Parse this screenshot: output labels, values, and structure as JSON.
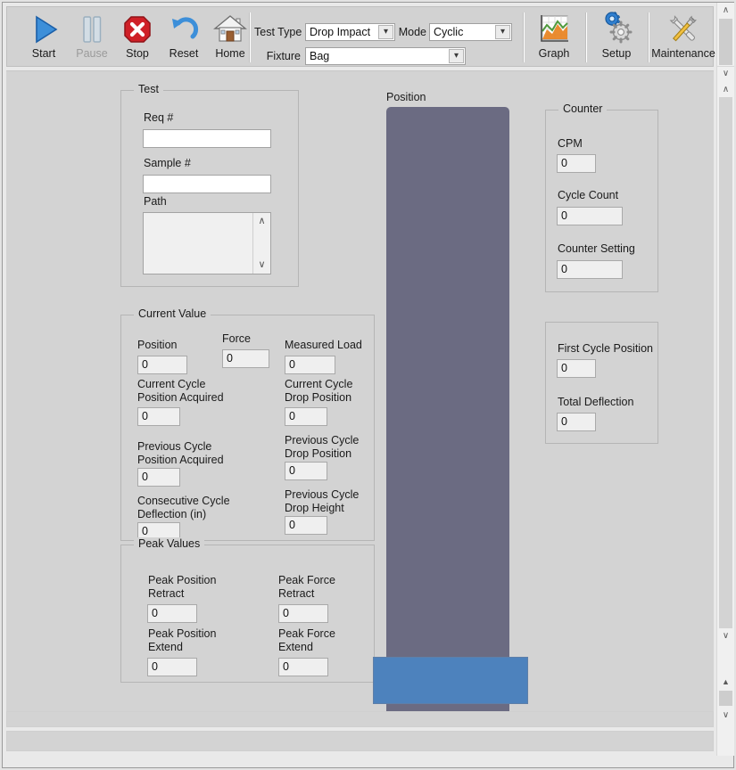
{
  "toolbar": {
    "buttons": [
      {
        "label": "Start",
        "icon": "play-icon",
        "enabled": true
      },
      {
        "label": "Pause",
        "icon": "pause-icon",
        "enabled": false
      },
      {
        "label": "Stop",
        "icon": "stop-icon",
        "enabled": true
      },
      {
        "label": "Reset",
        "icon": "reset-icon",
        "enabled": true
      },
      {
        "label": "Home",
        "icon": "home-icon",
        "enabled": true
      }
    ],
    "right_buttons": [
      {
        "label": "Graph",
        "icon": "chart-icon"
      },
      {
        "label": "Setup",
        "icon": "gears-icon"
      },
      {
        "label": "Maintenance",
        "icon": "tools-icon"
      }
    ]
  },
  "controls": {
    "test_type_label": "Test Type",
    "test_type_value": "Drop Impact",
    "mode_label": "Mode",
    "mode_value": "Cyclic",
    "fixture_label": "Fixture",
    "fixture_value": "Bag"
  },
  "test_panel": {
    "title": "Test",
    "req_label": "Req #",
    "req_value": "",
    "req_placeholder": "",
    "sample_label": "Sample #",
    "sample_value": "",
    "sample_placeholder": "",
    "path_label": "Path",
    "path_value": ""
  },
  "current_value_panel": {
    "title": "Current Value",
    "fields": [
      {
        "label": "Position",
        "value": "0"
      },
      {
        "label": "Force",
        "value": "0"
      },
      {
        "label": "Measured Load",
        "value": "0"
      },
      {
        "label": "Current Cycle\nPosition Acquired",
        "value": "0"
      },
      {
        "label": "Current Cycle\nDrop Position",
        "value": "0"
      },
      {
        "label": "Previous Cycle\nPosition Acquired",
        "value": "0"
      },
      {
        "label": "Previous Cycle\nDrop Position",
        "value": "0"
      },
      {
        "label": "Consecutive Cycle\nDeflection (in)",
        "value": "0"
      },
      {
        "label": "Previous Cycle\nDrop Height",
        "value": "0"
      }
    ]
  },
  "peak_values_panel": {
    "title": "Peak Values",
    "fields": [
      {
        "label": "Peak Position\nRetract",
        "value": "0"
      },
      {
        "label": "Peak Force\nRetract",
        "value": "0"
      },
      {
        "label": "Peak Position\nExtend",
        "value": "0"
      },
      {
        "label": "Peak Force\nExtend",
        "value": "0"
      }
    ]
  },
  "position_display": {
    "title": "Position",
    "column_color": "#6b6b82",
    "base_color": "#4d82bd"
  },
  "counter_panel": {
    "title": "Counter",
    "fields": [
      {
        "label": "CPM",
        "value": "0"
      },
      {
        "label": "Cycle Count",
        "value": "0"
      },
      {
        "label": "Counter Setting",
        "value": "0"
      }
    ]
  },
  "deflection_panel": {
    "fields": [
      {
        "label": "First Cycle Position",
        "value": "0"
      },
      {
        "label": "Total Deflection",
        "value": "0"
      }
    ]
  },
  "scrollbars": {
    "up_arrow": "▲",
    "down_arrow": "▼",
    "chevron_up": "∧",
    "chevron_down": "∨"
  }
}
